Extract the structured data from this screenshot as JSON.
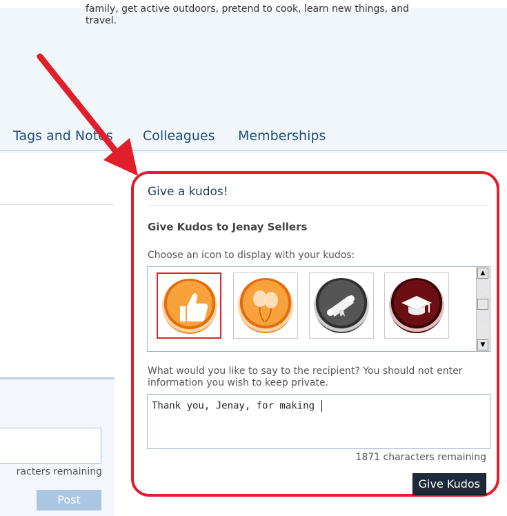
{
  "bio": {
    "line1": "family, get active outdoors, pretend to cook, learn new things, and",
    "line2": "travel."
  },
  "tabs": [
    {
      "label": "Tags and Notes"
    },
    {
      "label": "Colleagues"
    },
    {
      "label": "Memberships"
    }
  ],
  "left_panel": {
    "remaining": "racters remaining",
    "post_label": "Post"
  },
  "kudos": {
    "heading": "Give a kudos!",
    "subtitle": "Give Kudos to Jenay Sellers",
    "choose_label": "Choose an icon to display with your kudos:",
    "icons": [
      {
        "name": "thumbs-up-icon",
        "selected": true
      },
      {
        "name": "balloons-icon",
        "selected": false
      },
      {
        "name": "diploma-scroll-icon",
        "selected": false
      },
      {
        "name": "graduation-cap-icon",
        "selected": false
      }
    ],
    "prompt": "What would you like to say to the recipient? You should not enter information you wish to keep private.",
    "message": "Thank you, Jenay, for making ",
    "remaining": "1871 characters remaining",
    "submit_label": "Give Kudos"
  },
  "colors": {
    "accent_red": "#e21e2a",
    "tab_text": "#1f4d7a",
    "button_dark": "#1c2a3a",
    "post_button": "#aac6e0"
  }
}
